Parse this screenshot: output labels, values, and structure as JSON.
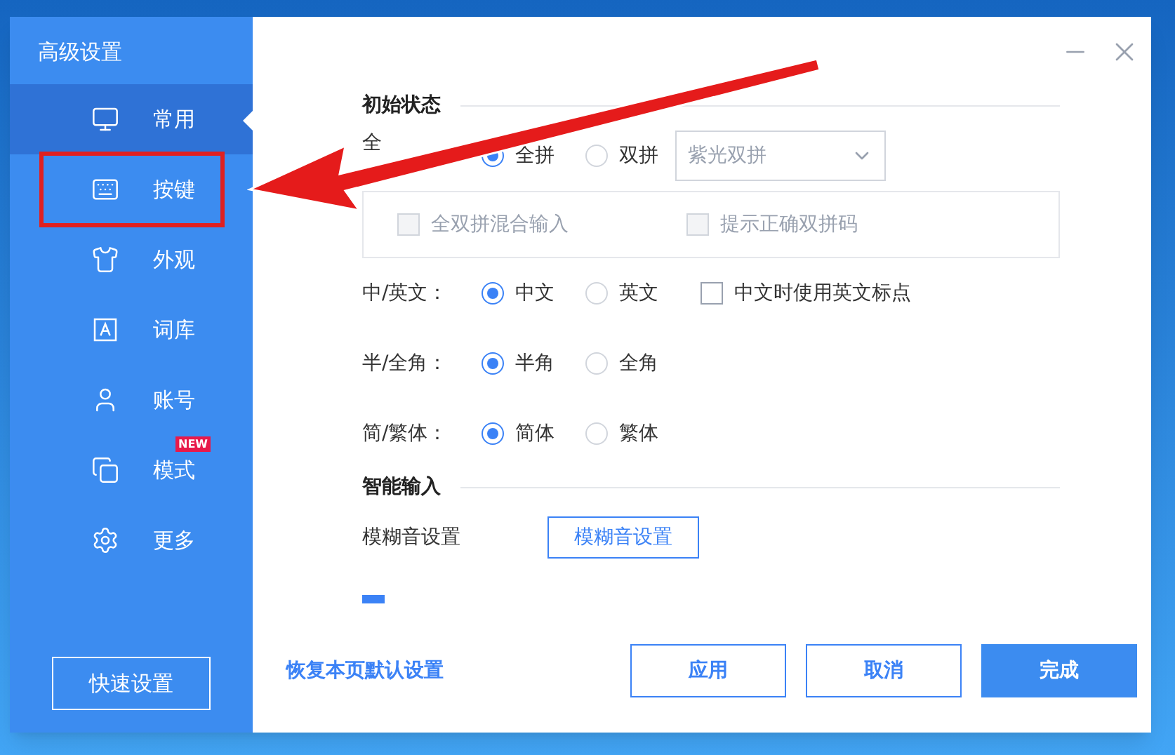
{
  "window": {
    "title": "高级设置"
  },
  "sidebar": {
    "items": [
      {
        "label": "常用",
        "selected": true,
        "highlighted": false
      },
      {
        "label": "按键",
        "selected": false,
        "highlighted": true
      },
      {
        "label": "外观",
        "selected": false,
        "highlighted": false
      },
      {
        "label": "词库",
        "selected": false,
        "highlighted": false
      },
      {
        "label": "账号",
        "selected": false,
        "highlighted": false
      },
      {
        "label": "模式",
        "selected": false,
        "highlighted": false,
        "badge": "NEW"
      },
      {
        "label": "更多",
        "selected": false,
        "highlighted": false
      }
    ],
    "quick_button": "快速设置"
  },
  "sections": [
    {
      "title": "初始状态",
      "rows": [
        {
          "kind": "radio",
          "label": "全",
          "options": [
            {
              "label": "全拼",
              "selected": true
            },
            {
              "label": "双拼",
              "selected": false
            }
          ],
          "dropdown": {
            "value": "紫光双拼",
            "disabled": true
          },
          "group": [
            {
              "label": "全双拼混合输入",
              "checked": false,
              "disabled": true
            },
            {
              "label": "提示正确双拼码",
              "checked": false,
              "disabled": true
            }
          ]
        },
        {
          "kind": "radio",
          "label": "中/英文：",
          "options": [
            {
              "label": "中文",
              "selected": true
            },
            {
              "label": "英文",
              "selected": false
            }
          ],
          "checkbox": {
            "label": "中文时使用英文标点",
            "checked": false
          }
        },
        {
          "kind": "radio",
          "label": "半/全角：",
          "options": [
            {
              "label": "半角",
              "selected": true
            },
            {
              "label": "全角",
              "selected": false
            }
          ]
        },
        {
          "kind": "radio",
          "label": "简/繁体：",
          "options": [
            {
              "label": "简体",
              "selected": true
            },
            {
              "label": "繁体",
              "selected": false
            }
          ]
        }
      ]
    },
    {
      "title": "智能输入",
      "rows": [
        {
          "kind": "button",
          "label": "模糊音设置",
          "button": "模糊音设置"
        },
        {
          "kind": "clipped-checkbox",
          "checked": true
        }
      ]
    }
  ],
  "footer": {
    "link": "恢复本页默认设置",
    "buttons": [
      {
        "label": "应用",
        "primary": false
      },
      {
        "label": "取消",
        "primary": false
      },
      {
        "label": "完成",
        "primary": true
      }
    ]
  }
}
